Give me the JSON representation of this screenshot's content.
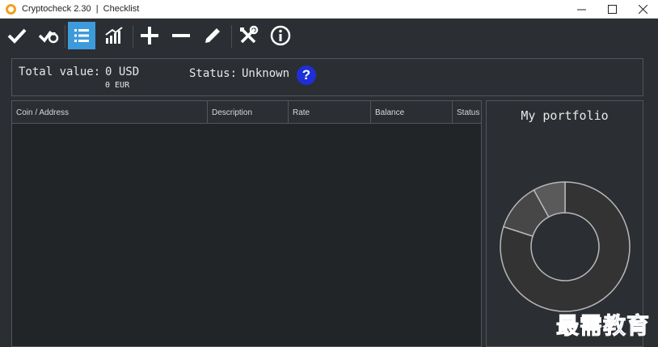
{
  "window": {
    "title": "Cryptocheck 2.30  |  Checklist",
    "controls": [
      "minimize-icon",
      "maximize-icon",
      "close-icon"
    ]
  },
  "toolbar": {
    "buttons": [
      {
        "icon": "checkmark-icon",
        "active": false
      },
      {
        "icon": "check-refresh-icon",
        "active": false
      },
      {
        "icon": "list-icon",
        "active": true
      },
      {
        "icon": "bar-chart-icon",
        "active": false
      },
      {
        "icon": "plus-icon",
        "active": false
      },
      {
        "icon": "minus-icon",
        "active": false
      },
      {
        "icon": "pencil-icon",
        "active": false
      },
      {
        "icon": "tools-icon",
        "active": false
      },
      {
        "icon": "info-icon",
        "active": false
      }
    ],
    "accent_color": "#3d9bdc"
  },
  "summary": {
    "total_label": "Total value:",
    "total_usd": "0 USD",
    "total_eur": "0 EUR",
    "status_label": "Status:",
    "status_value": "Unknown",
    "help_label": "?",
    "help_color": "#1e2fd8"
  },
  "table": {
    "columns": [
      "Coin / Address",
      "Description",
      "Rate",
      "Balance",
      "Status"
    ],
    "rows": []
  },
  "portfolio": {
    "title": "My portfolio",
    "slices": [
      {
        "fraction": 0.8,
        "color": "#333333"
      },
      {
        "fraction": 0.12,
        "color": "#474747"
      },
      {
        "fraction": 0.08,
        "color": "#5a5a5a"
      }
    ]
  },
  "watermark": "最需教育"
}
